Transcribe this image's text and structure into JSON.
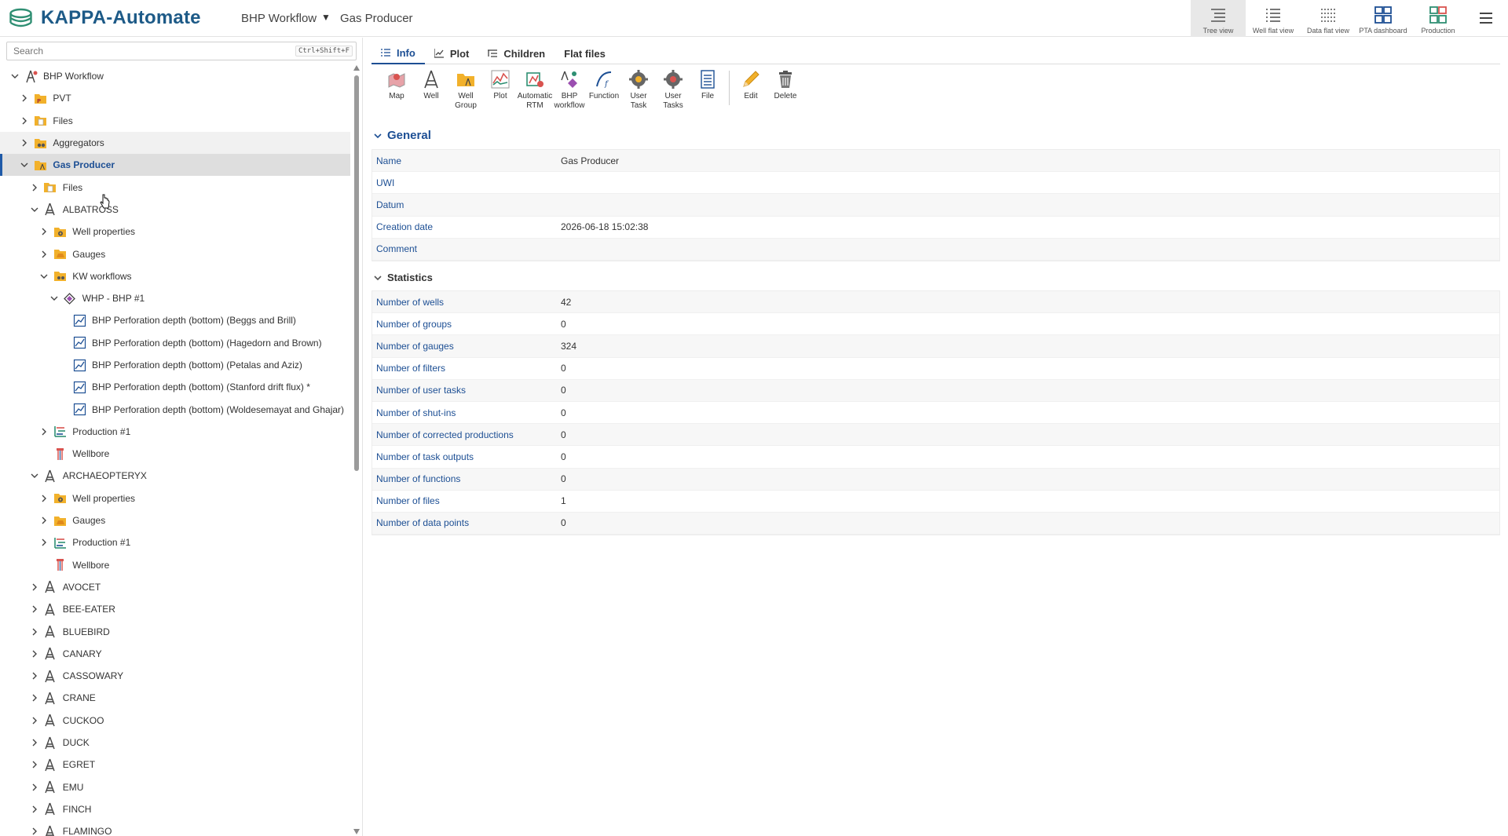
{
  "app": {
    "title": "KAPPA-Automate"
  },
  "breadcrumb": {
    "workflow": "BHP Workflow",
    "current": "Gas Producer"
  },
  "view_buttons": [
    {
      "label": "Tree view",
      "icon": "tree-view-icon",
      "active": true
    },
    {
      "label": "Well flat view",
      "icon": "well-flat-view-icon",
      "active": false
    },
    {
      "label": "Data flat view",
      "icon": "data-flat-view-icon",
      "active": false
    },
    {
      "label": "PTA dashboard",
      "icon": "pta-dashboard-icon",
      "active": false
    },
    {
      "label": "Production",
      "icon": "production-dashboard-icon",
      "active": false
    }
  ],
  "search": {
    "placeholder": "Search",
    "shortcut": "Ctrl+Shift+F"
  },
  "tree": [
    {
      "label": "BHP Workflow",
      "depth": 0,
      "expanded": true,
      "icon": "field-icon"
    },
    {
      "label": "PVT",
      "depth": 1,
      "expanded": false,
      "icon": "pvt-folder-icon"
    },
    {
      "label": "Files",
      "depth": 1,
      "expanded": false,
      "icon": "files-folder-icon"
    },
    {
      "label": "Aggregators",
      "depth": 1,
      "expanded": false,
      "icon": "aggregators-folder-icon",
      "state": "hover"
    },
    {
      "label": "Gas Producer",
      "depth": 1,
      "expanded": true,
      "icon": "well-group-folder-icon",
      "state": "selected"
    },
    {
      "label": "Files",
      "depth": 2,
      "expanded": false,
      "icon": "files-folder-icon"
    },
    {
      "label": "ALBATROSS",
      "depth": 2,
      "expanded": true,
      "icon": "well-icon"
    },
    {
      "label": "Well properties",
      "depth": 3,
      "expanded": false,
      "icon": "well-properties-folder-icon"
    },
    {
      "label": "Gauges",
      "depth": 3,
      "expanded": false,
      "icon": "gauges-folder-icon"
    },
    {
      "label": "KW workflows",
      "depth": 3,
      "expanded": true,
      "icon": "kw-workflows-folder-icon"
    },
    {
      "label": "WHP - BHP #1",
      "depth": 4,
      "expanded": true,
      "icon": "bhp-workflow-icon"
    },
    {
      "label": "BHP Perforation depth (bottom) (Beggs and Brill)",
      "depth": 5,
      "leaf": true,
      "icon": "data-chart-icon"
    },
    {
      "label": "BHP Perforation depth (bottom) (Hagedorn and Brown)",
      "depth": 5,
      "leaf": true,
      "icon": "data-chart-icon"
    },
    {
      "label": "BHP Perforation depth (bottom) (Petalas and Aziz)",
      "depth": 5,
      "leaf": true,
      "icon": "data-chart-icon"
    },
    {
      "label": "BHP Perforation depth (bottom) (Stanford drift flux) *",
      "depth": 5,
      "leaf": true,
      "icon": "data-chart-icon"
    },
    {
      "label": "BHP Perforation depth (bottom) (Woldesemayat and Ghajar)",
      "depth": 5,
      "leaf": true,
      "icon": "data-chart-icon"
    },
    {
      "label": "Production #1",
      "depth": 3,
      "expanded": false,
      "icon": "production-icon"
    },
    {
      "label": "Wellbore",
      "depth": 3,
      "leaf": true,
      "icon": "wellbore-icon"
    },
    {
      "label": "ARCHAEOPTERYX",
      "depth": 2,
      "expanded": true,
      "icon": "well-icon"
    },
    {
      "label": "Well properties",
      "depth": 3,
      "expanded": false,
      "icon": "well-properties-folder-icon"
    },
    {
      "label": "Gauges",
      "depth": 3,
      "expanded": false,
      "icon": "gauges-folder-icon"
    },
    {
      "label": "Production #1",
      "depth": 3,
      "expanded": false,
      "icon": "production-icon"
    },
    {
      "label": "Wellbore",
      "depth": 3,
      "leaf": true,
      "icon": "wellbore-icon"
    },
    {
      "label": "AVOCET",
      "depth": 2,
      "expanded": false,
      "icon": "well-icon"
    },
    {
      "label": "BEE-EATER",
      "depth": 2,
      "expanded": false,
      "icon": "well-icon"
    },
    {
      "label": "BLUEBIRD",
      "depth": 2,
      "expanded": false,
      "icon": "well-icon"
    },
    {
      "label": "CANARY",
      "depth": 2,
      "expanded": false,
      "icon": "well-icon"
    },
    {
      "label": "CASSOWARY",
      "depth": 2,
      "expanded": false,
      "icon": "well-icon"
    },
    {
      "label": "CRANE",
      "depth": 2,
      "expanded": false,
      "icon": "well-icon"
    },
    {
      "label": "CUCKOO",
      "depth": 2,
      "expanded": false,
      "icon": "well-icon"
    },
    {
      "label": "DUCK",
      "depth": 2,
      "expanded": false,
      "icon": "well-icon"
    },
    {
      "label": "EGRET",
      "depth": 2,
      "expanded": false,
      "icon": "well-icon"
    },
    {
      "label": "EMU",
      "depth": 2,
      "expanded": false,
      "icon": "well-icon"
    },
    {
      "label": "FINCH",
      "depth": 2,
      "expanded": false,
      "icon": "well-icon"
    },
    {
      "label": "FLAMINGO",
      "depth": 2,
      "expanded": false,
      "icon": "well-icon"
    }
  ],
  "tabs": [
    {
      "label": "Info",
      "icon": "info-list-icon",
      "active": true
    },
    {
      "label": "Plot",
      "icon": "plot-icon",
      "active": false
    },
    {
      "label": "Children",
      "icon": "children-icon",
      "active": false
    },
    {
      "label": "Flat files",
      "icon": "",
      "active": false
    }
  ],
  "toolbar": [
    {
      "label": "Map",
      "icon": "map-icon"
    },
    {
      "label": "Well",
      "icon": "well-icon"
    },
    {
      "label": "Well Group",
      "icon": "well-group-icon"
    },
    {
      "label": "Plot",
      "icon": "plot-icon"
    },
    {
      "label": "Automatic RTM",
      "icon": "automatic-rtm-icon"
    },
    {
      "label": "BHP workflow",
      "icon": "bhp-workflow-icon"
    },
    {
      "label": "Function",
      "icon": "function-icon"
    },
    {
      "label": "User Task",
      "icon": "user-task-icon"
    },
    {
      "label": "User Tasks",
      "icon": "user-tasks-icon"
    },
    {
      "label": "File",
      "icon": "file-icon"
    },
    {
      "label": "Edit",
      "icon": "edit-pencil-icon"
    },
    {
      "label": "Delete",
      "icon": "delete-trash-icon"
    }
  ],
  "general": {
    "title": "General",
    "rows": [
      {
        "key": "Name",
        "value": "Gas Producer"
      },
      {
        "key": "UWI",
        "value": ""
      },
      {
        "key": "Datum",
        "value": ""
      },
      {
        "key": "Creation date",
        "value": "2026-06-18 15:02:38"
      },
      {
        "key": "Comment",
        "value": ""
      }
    ]
  },
  "statistics": {
    "title": "Statistics",
    "rows": [
      {
        "key": "Number of wells",
        "value": "42"
      },
      {
        "key": "Number of groups",
        "value": "0"
      },
      {
        "key": "Number of gauges",
        "value": "324"
      },
      {
        "key": "Number of filters",
        "value": "0"
      },
      {
        "key": "Number of user tasks",
        "value": "0"
      },
      {
        "key": "Number of shut-ins",
        "value": "0"
      },
      {
        "key": "Number of corrected productions",
        "value": "0"
      },
      {
        "key": "Number of task outputs",
        "value": "0"
      },
      {
        "key": "Number of functions",
        "value": "0"
      },
      {
        "key": "Number of files",
        "value": "1"
      },
      {
        "key": "Number of data points",
        "value": "0"
      }
    ]
  },
  "colors": {
    "brand": "#1d5a87",
    "accent": "#1d4f94",
    "folder": "#f2b12b",
    "selected_bg": "#dedede"
  }
}
